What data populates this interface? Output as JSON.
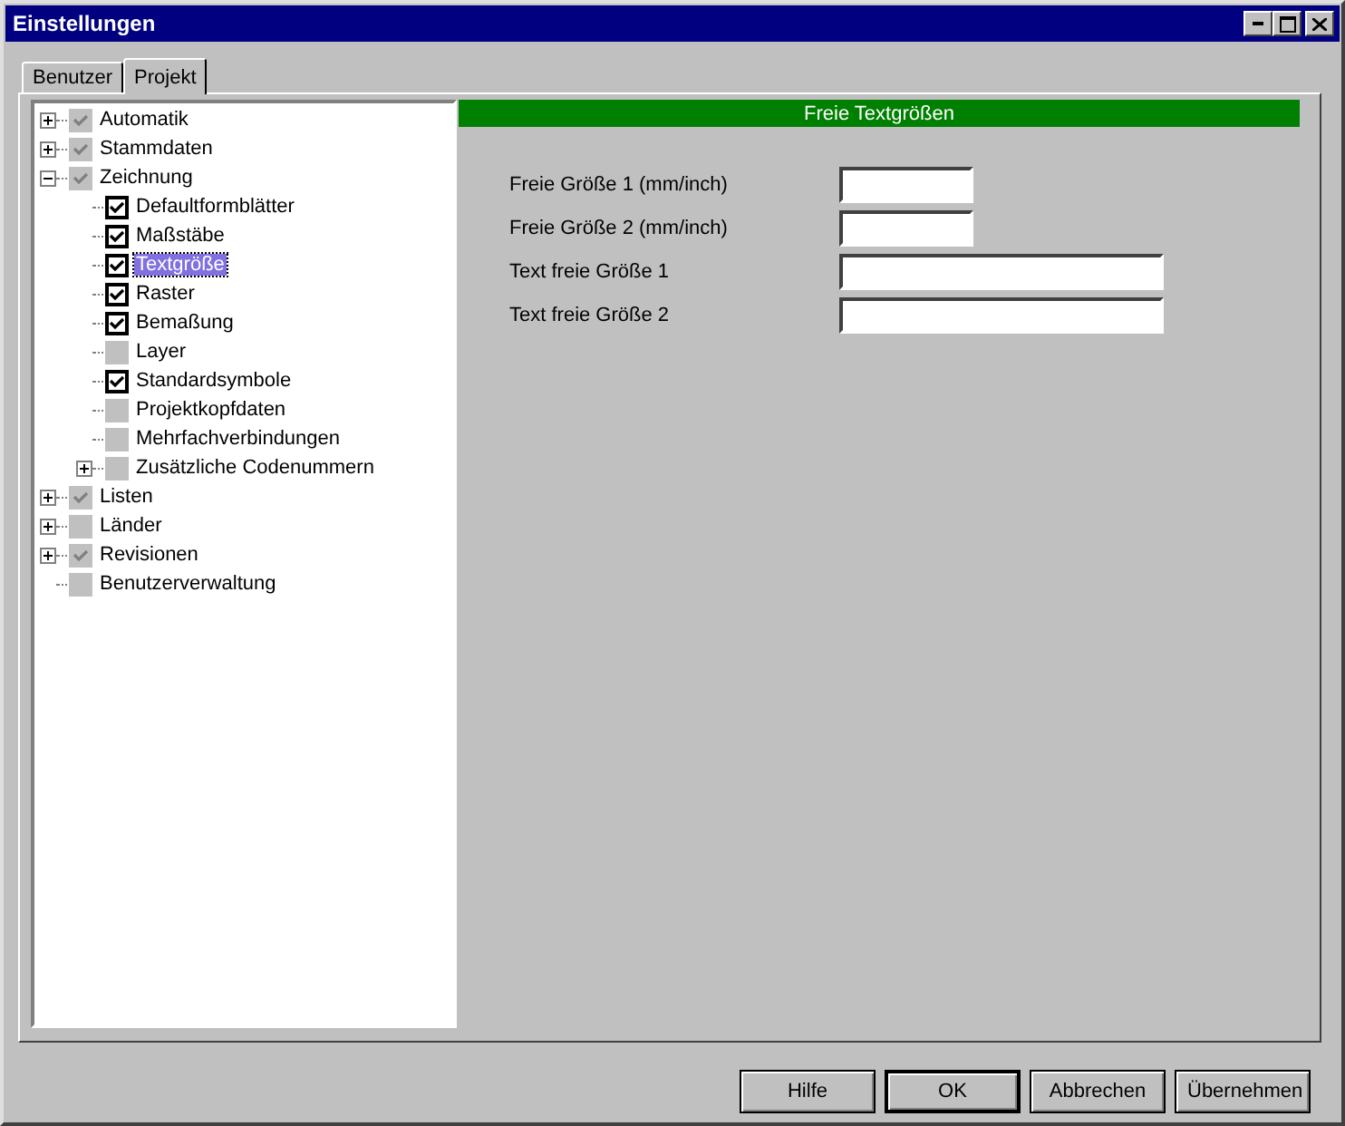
{
  "window": {
    "title": "Einstellungen"
  },
  "tabs": [
    {
      "label": "Benutzer",
      "selected": false
    },
    {
      "label": "Projekt",
      "selected": true
    }
  ],
  "tree": [
    {
      "label": "Automatik",
      "checked": true,
      "disabled": true,
      "expanded": false,
      "selected": false
    },
    {
      "label": "Stammdaten",
      "checked": true,
      "disabled": true,
      "expanded": false,
      "selected": false
    },
    {
      "label": "Zeichnung",
      "checked": true,
      "disabled": true,
      "expanded": true,
      "selected": false,
      "children": [
        {
          "label": "Defaultformblätter",
          "checked": true,
          "disabled": false,
          "selected": false
        },
        {
          "label": "Maßstäbe",
          "checked": true,
          "disabled": false,
          "selected": false
        },
        {
          "label": "Textgröße",
          "checked": true,
          "disabled": false,
          "selected": true
        },
        {
          "label": "Raster",
          "checked": true,
          "disabled": false,
          "selected": false
        },
        {
          "label": "Bemaßung",
          "checked": true,
          "disabled": false,
          "selected": false
        },
        {
          "label": "Layer",
          "checked": false,
          "disabled": true,
          "selected": false
        },
        {
          "label": "Standardsymbole",
          "checked": true,
          "disabled": false,
          "selected": false
        },
        {
          "label": "Projektkopfdaten",
          "checked": false,
          "disabled": true,
          "selected": false
        },
        {
          "label": "Mehrfachverbindungen",
          "checked": false,
          "disabled": true,
          "selected": false
        },
        {
          "label": "Zusätzliche Codenummern",
          "checked": false,
          "disabled": true,
          "expanded": false,
          "selected": false
        }
      ]
    },
    {
      "label": "Listen",
      "checked": true,
      "disabled": true,
      "expanded": false,
      "selected": false
    },
    {
      "label": "Länder",
      "checked": false,
      "disabled": true,
      "expanded": false,
      "selected": false
    },
    {
      "label": "Revisionen",
      "checked": true,
      "disabled": true,
      "expanded": false,
      "selected": false
    },
    {
      "label": "Benutzerverwaltung",
      "checked": false,
      "disabled": true,
      "selected": false
    }
  ],
  "panel": {
    "title": "Freie Textgrößen",
    "fields": [
      {
        "label": "Freie Größe 1 (mm/inch)",
        "kind": "short"
      },
      {
        "label": "Freie Größe 2 (mm/inch)",
        "kind": "short"
      },
      {
        "label": "Text freie Größe 1",
        "kind": "long"
      },
      {
        "label": "Text freie Größe 2",
        "kind": "long"
      }
    ]
  },
  "buttons": [
    {
      "label": "Hilfe",
      "default": false
    },
    {
      "label": "OK",
      "default": true
    },
    {
      "label": "Abbrechen",
      "default": false
    },
    {
      "label": "Übernehmen",
      "default": false
    }
  ]
}
